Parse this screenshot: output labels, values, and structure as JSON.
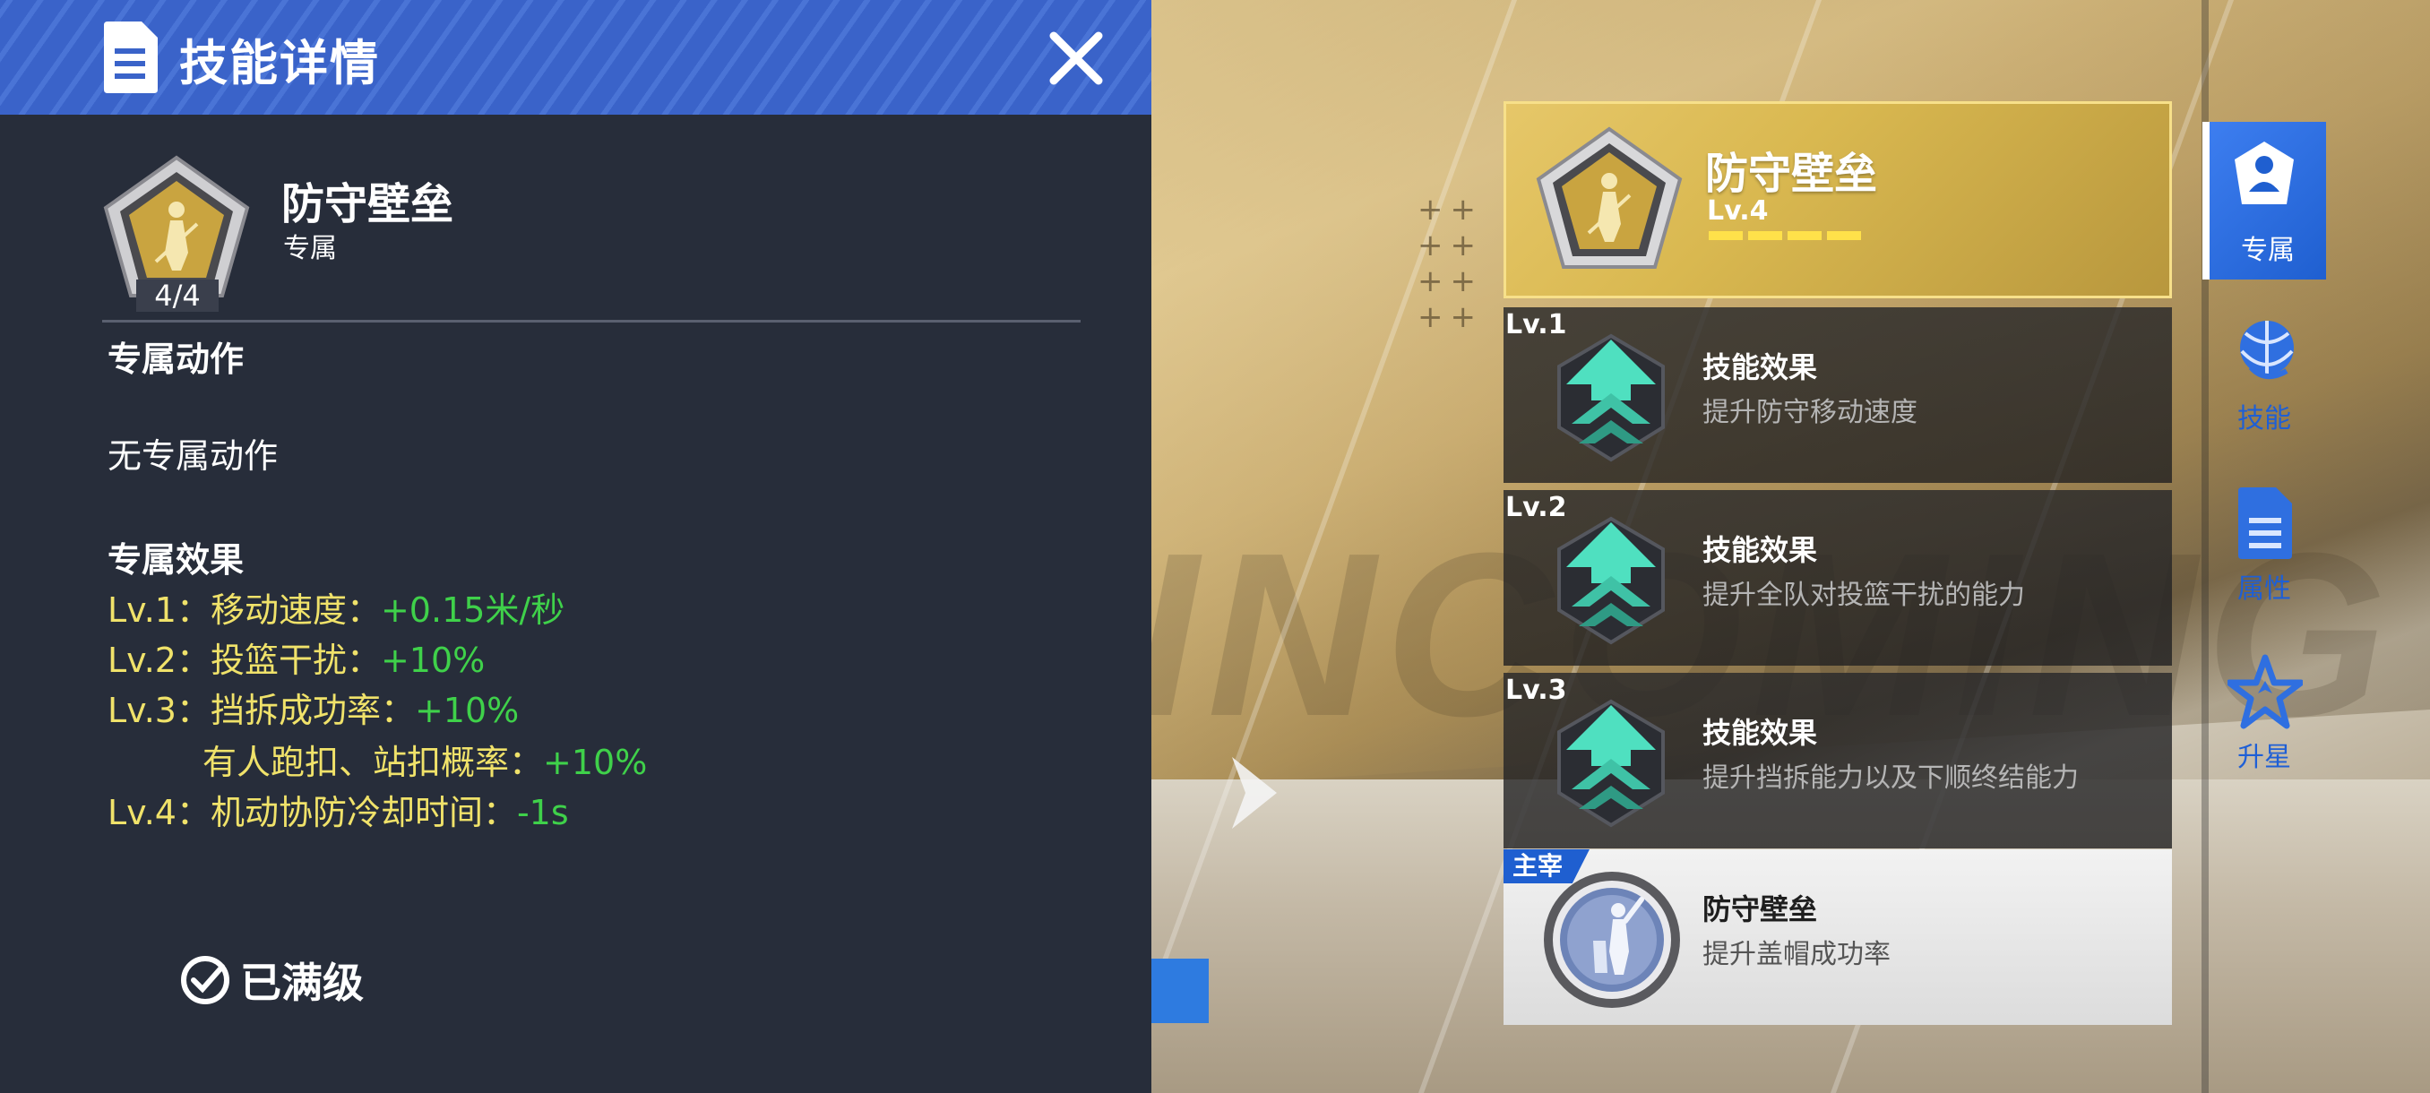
{
  "panel": {
    "title": "技能详情",
    "skill": {
      "name": "防守壁垒",
      "type": "专属",
      "level_badge": "4/4"
    },
    "sections": {
      "action_title": "专属动作",
      "action_text": "无专属动作",
      "effect_title": "专属效果"
    },
    "effects": [
      {
        "label": "Lv.1：移动速度：",
        "value": "+0.15米/秒"
      },
      {
        "label": "Lv.2：投篮干扰：",
        "value": "+10%"
      },
      {
        "label": "Lv.3：挡拆成功率：",
        "value": "+10%"
      },
      {
        "label": "有人跑扣、站扣概率：",
        "value": "+10%"
      },
      {
        "label": "Lv.4：机动协防冷却时间：",
        "value": "-1s"
      }
    ],
    "maxed_label": "已满级"
  },
  "skill_list": {
    "main": {
      "name": "防守壁垒",
      "level": "Lv.4",
      "progress_filled": 4,
      "progress_total": 4
    },
    "levels": [
      {
        "tag": "Lv.1",
        "title": "技能效果",
        "desc": "提升防守移动速度"
      },
      {
        "tag": "Lv.2",
        "title": "技能效果",
        "desc": "提升全队对投篮干扰的能力"
      },
      {
        "tag": "Lv.3",
        "title": "技能效果",
        "desc": "提升挡拆能力以及下顺终结能力"
      }
    ],
    "master": {
      "tag": "主宰",
      "name": "防守壁垒",
      "desc": "提升盖帽成功率"
    }
  },
  "side_tabs": [
    {
      "label": "专属",
      "icon": "exclusive-icon",
      "active": true
    },
    {
      "label": "技能",
      "icon": "basketball-icon",
      "active": false
    },
    {
      "label": "属性",
      "icon": "document-icon",
      "active": false
    },
    {
      "label": "升星",
      "icon": "star-icon",
      "active": false
    }
  ],
  "colors": {
    "header_blue": "#3a63c9",
    "effect_label": "#f0e26a",
    "effect_value": "#3fd14a",
    "accent_blue": "#1f5fd0",
    "gold": "#d9b850",
    "teal_arrow": "#4fe0c0"
  }
}
